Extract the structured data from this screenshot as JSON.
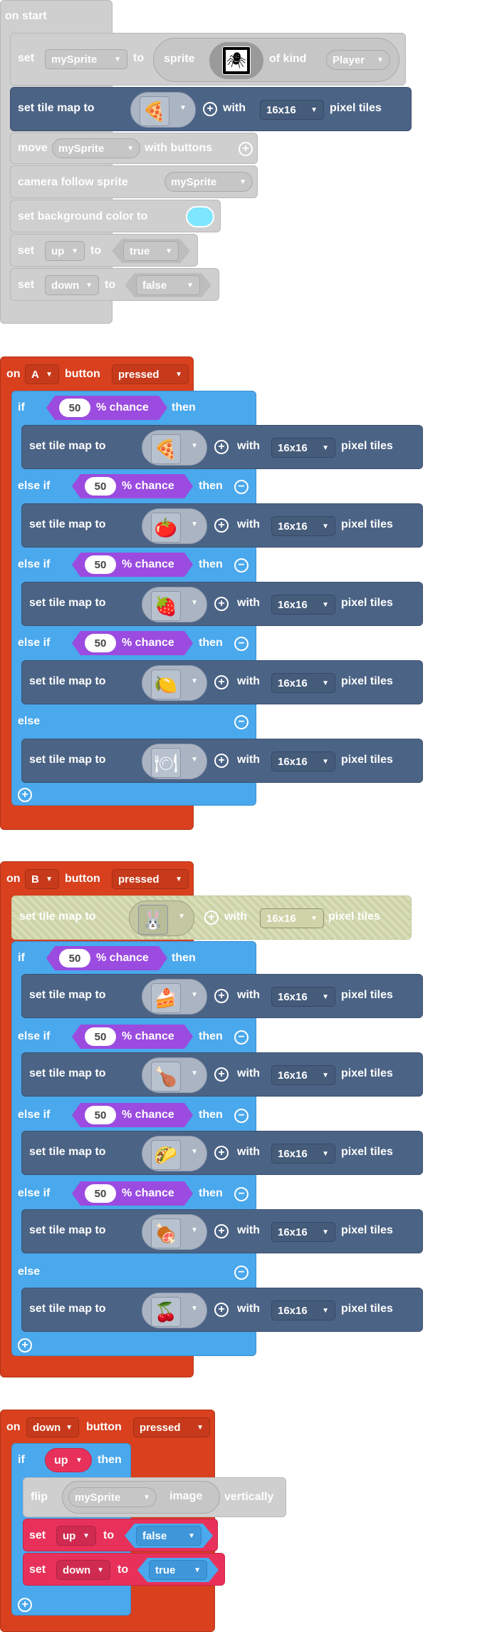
{
  "images": {
    "player": "🕷",
    "pizza": "🍕",
    "tomato": "🍅",
    "strawberry": "🍓",
    "lemon": "🍋",
    "plate": "🍽",
    "bunny": "🐰",
    "cake": "🍰",
    "drumstick": "🍗",
    "taco": "🌮",
    "ham": "🍖",
    "cherries": "🍒"
  },
  "on_start": {
    "title": "on start",
    "set_sprite": {
      "set": "set",
      "var": "mySprite",
      "to": "to",
      "sprite": "sprite",
      "of_kind": "of kind",
      "kind": "Player"
    },
    "tilemap": {
      "label": "set tile map to",
      "with": "with",
      "size": "16x16",
      "suffix": "pixel tiles"
    },
    "move": {
      "label": "move",
      "var": "mySprite",
      "suffix": "with buttons"
    },
    "camera": {
      "label": "camera follow sprite",
      "var": "mySprite"
    },
    "bg": {
      "label": "set background color to",
      "color": "#7fe6ff"
    },
    "set_up": {
      "set": "set",
      "var": "up",
      "to": "to",
      "value": "true"
    },
    "set_down": {
      "set": "set",
      "var": "down",
      "to": "to",
      "value": "false"
    }
  },
  "on_a": {
    "on": "on",
    "button": "A",
    "button_label": "button",
    "event": "pressed",
    "if": "if",
    "else_if": "else if",
    "else": "else",
    "then": "then",
    "chance_value": "50",
    "chance_label": "% chance",
    "tilemap_label": "set tile map to",
    "with": "with",
    "size": "16x16",
    "suffix": "pixel tiles"
  },
  "on_b": {
    "on": "on",
    "button": "B",
    "button_label": "button",
    "event": "pressed",
    "disabled_tilemap": {
      "label": "set tile map to",
      "with": "with",
      "size": "16x16",
      "suffix": "pixel tiles"
    },
    "if": "if",
    "else_if": "else if",
    "else": "else",
    "then": "then",
    "chance_value": "50",
    "chance_label": "% chance",
    "tilemap_label": "set tile map to",
    "with": "with",
    "size": "16x16",
    "suffix": "pixel tiles"
  },
  "on_down": {
    "on": "on",
    "button": "down",
    "button_label": "button",
    "event": "pressed",
    "if": "if",
    "cond": "up",
    "then": "then",
    "flip": {
      "label": "flip",
      "var": "mySprite",
      "image": "image",
      "suffix": "vertically"
    },
    "set_up": {
      "set": "set",
      "var": "up",
      "to": "to",
      "value": "false"
    },
    "set_down": {
      "set": "set",
      "var": "down",
      "to": "to",
      "value": "true"
    }
  },
  "colors": {
    "event_red": "#d8401e",
    "logic_blue": "#4aa8ec",
    "tile_slate": "#4b6385",
    "math_purple": "#9b4be0",
    "var_pink": "#e8315a",
    "sprite_grey": "#cfcfcf"
  }
}
